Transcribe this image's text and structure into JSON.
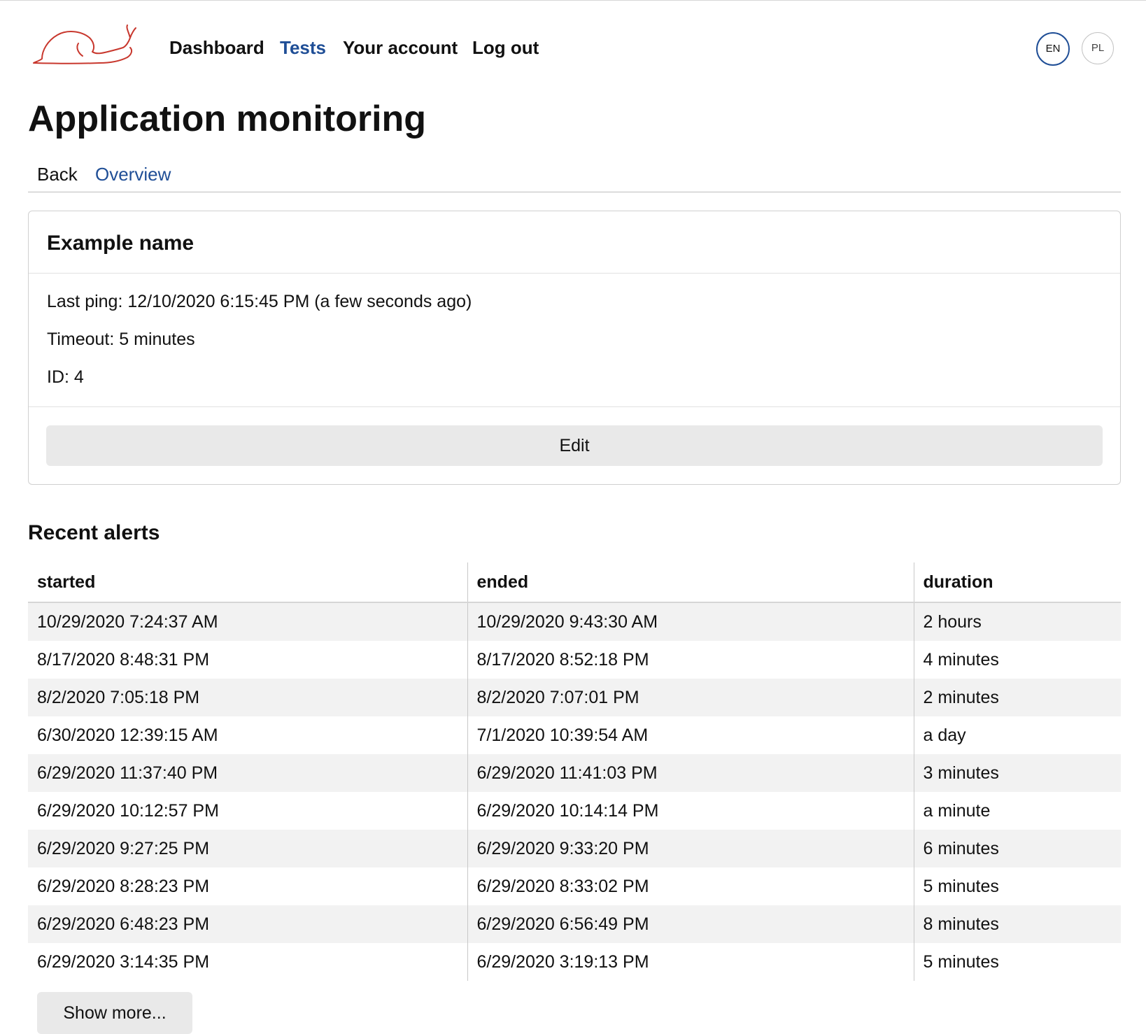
{
  "nav": {
    "links": [
      {
        "label": "Dashboard",
        "active": false
      },
      {
        "label": "Tests",
        "active": true
      },
      {
        "label": "Your account",
        "active": false
      },
      {
        "label": "Log out",
        "active": false
      }
    ],
    "languages": [
      {
        "label": "EN",
        "active": true
      },
      {
        "label": "PL",
        "active": false
      }
    ]
  },
  "page": {
    "title": "Application monitoring"
  },
  "subnav": {
    "back": "Back",
    "overview": "Overview"
  },
  "card": {
    "title": "Example name",
    "last_ping": "Last ping: 12/10/2020 6:15:45 PM (a few seconds ago)",
    "timeout": "Timeout: 5 minutes",
    "id": "ID: 4",
    "edit_label": "Edit"
  },
  "alerts": {
    "title": "Recent alerts",
    "headers": [
      "started",
      "ended",
      "duration"
    ],
    "rows": [
      [
        "10/29/2020 7:24:37 AM",
        "10/29/2020 9:43:30 AM",
        "2 hours"
      ],
      [
        "8/17/2020 8:48:31 PM",
        "8/17/2020 8:52:18 PM",
        "4 minutes"
      ],
      [
        "8/2/2020 7:05:18 PM",
        "8/2/2020 7:07:01 PM",
        "2 minutes"
      ],
      [
        "6/30/2020 12:39:15 AM",
        "7/1/2020 10:39:54 AM",
        "a day"
      ],
      [
        "6/29/2020 11:37:40 PM",
        "6/29/2020 11:41:03 PM",
        "3 minutes"
      ],
      [
        "6/29/2020 10:12:57 PM",
        "6/29/2020 10:14:14 PM",
        "a minute"
      ],
      [
        "6/29/2020 9:27:25 PM",
        "6/29/2020 9:33:20 PM",
        "6 minutes"
      ],
      [
        "6/29/2020 8:28:23 PM",
        "6/29/2020 8:33:02 PM",
        "5 minutes"
      ],
      [
        "6/29/2020 6:48:23 PM",
        "6/29/2020 6:56:49 PM",
        "8 minutes"
      ],
      [
        "6/29/2020 3:14:35 PM",
        "6/29/2020 3:19:13 PM",
        "5 minutes"
      ]
    ],
    "show_more_label": "Show more..."
  },
  "colors": {
    "accent": "#1f4e96",
    "logo": "#c8372d",
    "text": "#111111",
    "row_stripe": "#f2f2f2",
    "button_bg": "#e9e9e9"
  },
  "icons": {
    "logo": "snail-logo-icon"
  }
}
